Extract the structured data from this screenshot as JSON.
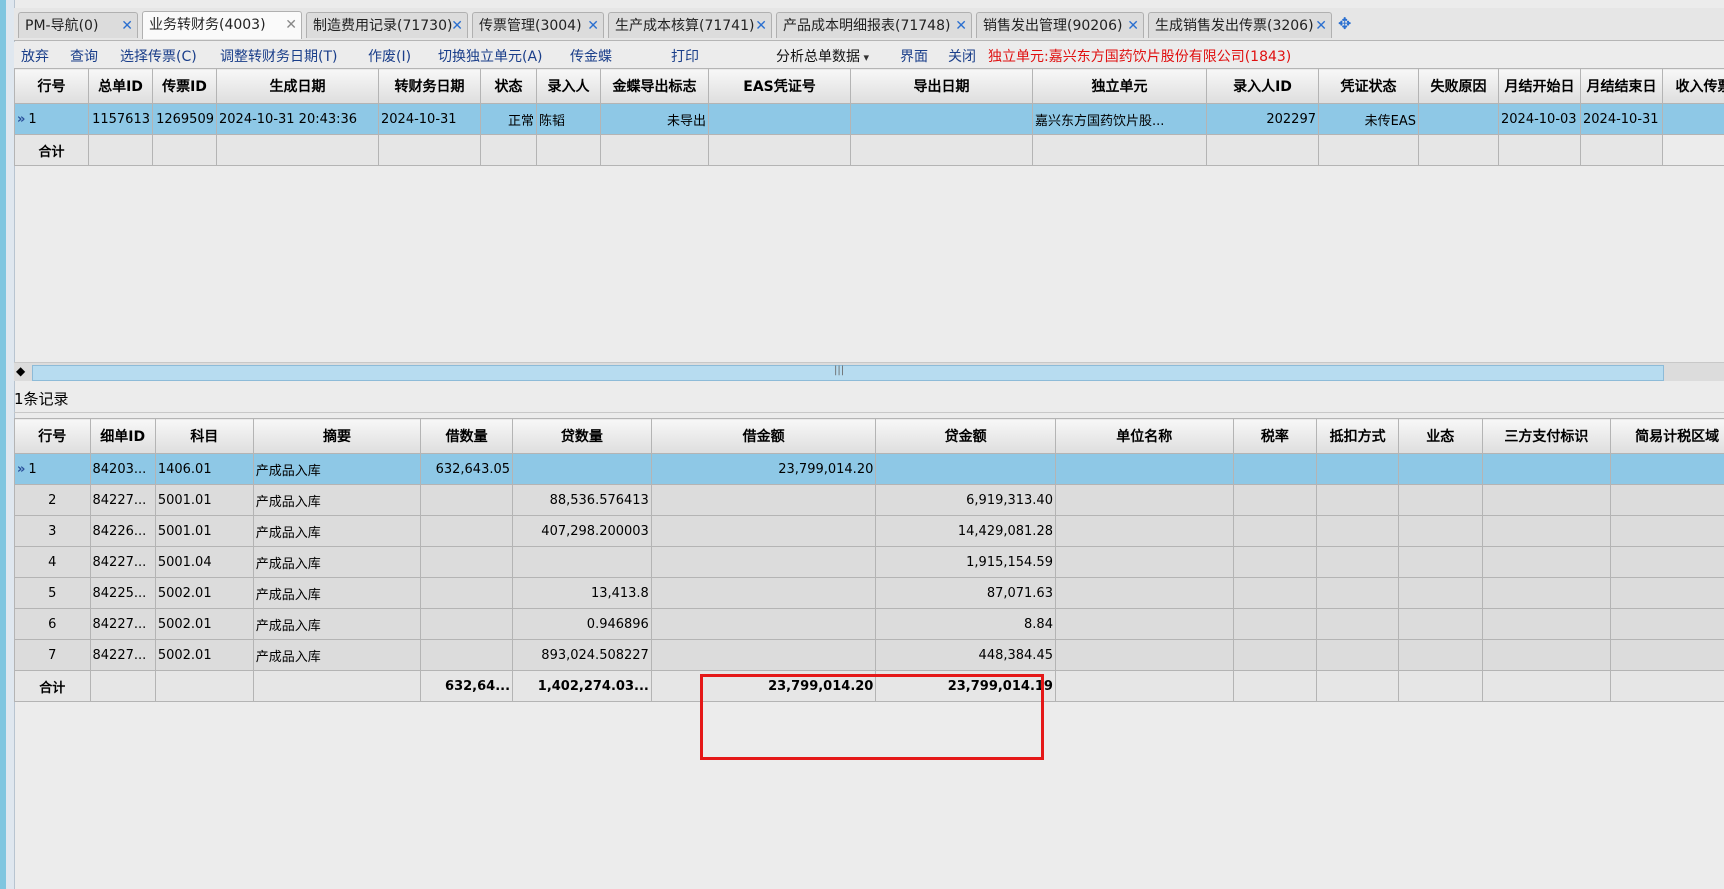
{
  "tabs": [
    {
      "label": "PM-导航(0)"
    },
    {
      "label": "业务转财务(4003)"
    },
    {
      "label": "制造费用记录(71730)"
    },
    {
      "label": "传票管理(3004)"
    },
    {
      "label": "生产成本核算(71741)"
    },
    {
      "label": "产品成本明细报表(71748)"
    },
    {
      "label": "销售发出管理(90206)"
    },
    {
      "label": "生成销售发出传票(3206)"
    }
  ],
  "toolbar": {
    "discard": "放弃",
    "query": "查询",
    "select_voucher": "选择传票(C)",
    "adjust_date": "调整转财务日期(T)",
    "void": "作废(I)",
    "switch_unit": "切换独立单元(A)",
    "send_kingdee": "传金蝶",
    "print": "打印",
    "analysis": "分析总单数据",
    "interface": "界面",
    "close": "关闭",
    "unit_label": "独立单元:嘉兴东方国药饮片股份有限公司(1843)"
  },
  "top_table": {
    "headers": [
      "行号",
      "总单ID",
      "传票ID",
      "生成日期",
      "转财务日期",
      "状态",
      "录入人",
      "金蝶导出标志",
      "EAS凭证号",
      "导出日期",
      "独立单元",
      "录入人ID",
      "凭证状态",
      "失败原因",
      "月结开始日",
      "月结结束日",
      "收入传票"
    ],
    "row": [
      "1",
      "1157613",
      "1269509",
      "2024-10-31 20:43:36",
      "2024-10-31",
      "正常",
      "陈韬",
      "未导出",
      "",
      "",
      "嘉兴东方国药饮片股...",
      "202297",
      "未传EAS",
      "",
      "2024-10-03",
      "2024-10-31",
      ""
    ],
    "total_label": "合计"
  },
  "record_count": "1条记录",
  "bottom_table": {
    "headers": [
      "行号",
      "细单ID",
      "科目",
      "摘要",
      "借数量",
      "贷数量",
      "借金额",
      "贷金额",
      "单位名称",
      "税率",
      "抵扣方式",
      "业态",
      "三方支付标识",
      "简易计税区域"
    ],
    "rows": [
      [
        "1",
        "84203...",
        "1406.01",
        "产成品入库",
        "632,643.05",
        "",
        "23,799,014.20",
        "",
        "",
        "",
        "",
        "",
        "",
        ""
      ],
      [
        "2",
        "84227...",
        "5001.01",
        "产成品入库",
        "",
        "88,536.576413",
        "",
        "6,919,313.40",
        "",
        "",
        "",
        "",
        "",
        ""
      ],
      [
        "3",
        "84226...",
        "5001.01",
        "产成品入库",
        "",
        "407,298.200003",
        "",
        "14,429,081.28",
        "",
        "",
        "",
        "",
        "",
        ""
      ],
      [
        "4",
        "84227...",
        "5001.04",
        "产成品入库",
        "",
        "",
        "",
        "1,915,154.59",
        "",
        "",
        "",
        "",
        "",
        ""
      ],
      [
        "5",
        "84225...",
        "5002.01",
        "产成品入库",
        "",
        "13,413.8",
        "",
        "87,071.63",
        "",
        "",
        "",
        "",
        "",
        ""
      ],
      [
        "6",
        "84227...",
        "5002.01",
        "产成品入库",
        "",
        "0.946896",
        "",
        "8.84",
        "",
        "",
        "",
        "",
        "",
        ""
      ],
      [
        "7",
        "84227...",
        "5002.01",
        "产成品入库",
        "",
        "893,024.508227",
        "",
        "448,384.45",
        "",
        "",
        "",
        "",
        "",
        ""
      ]
    ],
    "total": [
      "合计",
      "",
      "",
      "",
      "632,64...",
      "1,402,274.03...",
      "23,799,014.20",
      "23,799,014.19",
      "",
      "",
      "",
      "",
      "",
      ""
    ]
  },
  "colors": {
    "selected_row": "#8ec8e6",
    "highlight_box": "#e51818",
    "link_text": "#1a3e8a",
    "tab_close": "#2a6fd0"
  }
}
